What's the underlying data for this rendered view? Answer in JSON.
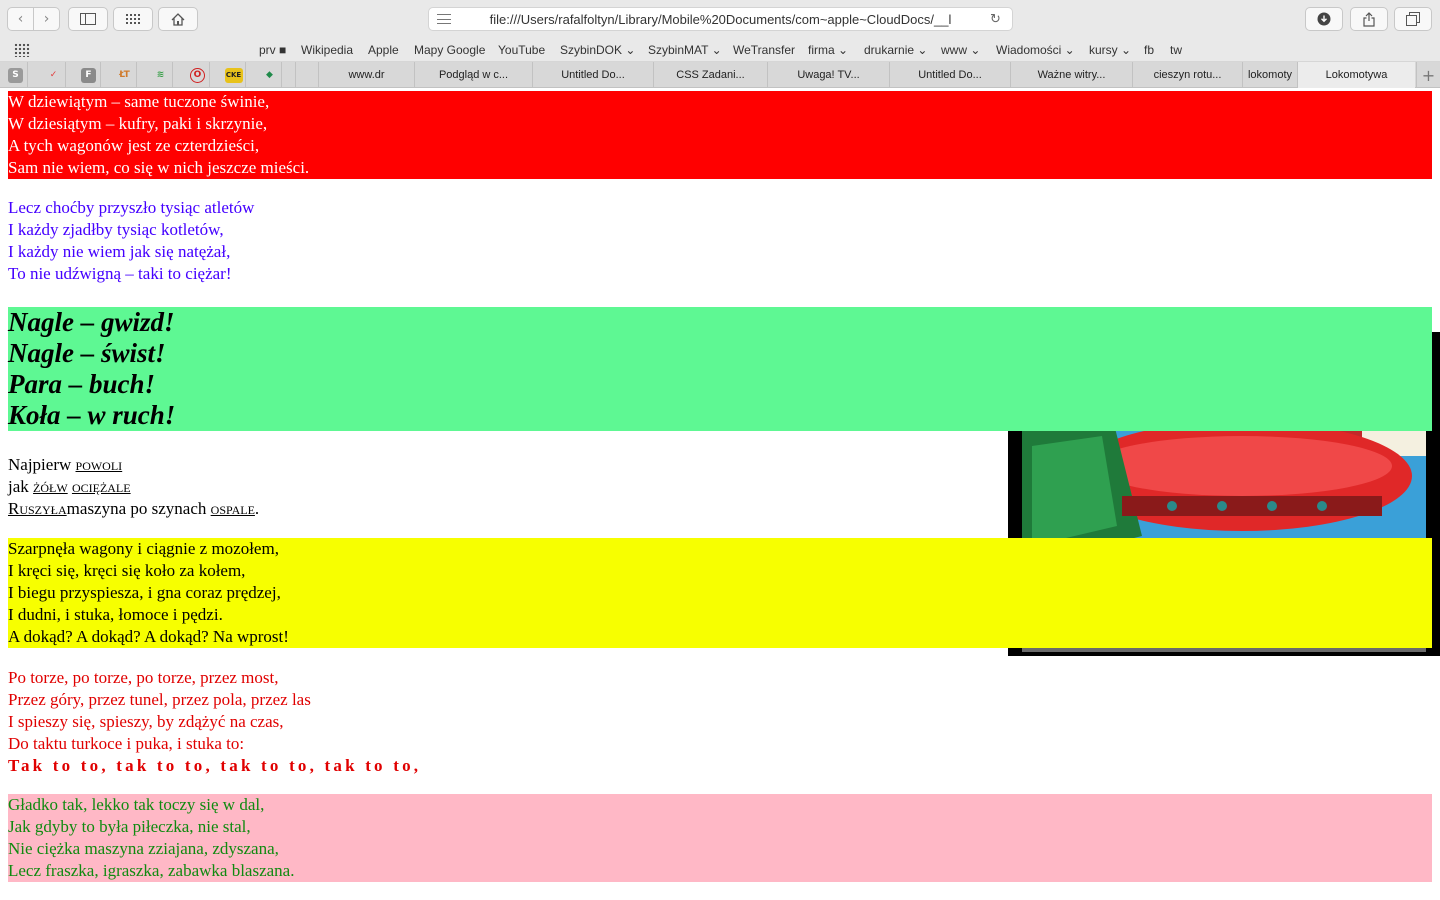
{
  "browser": {
    "url": "file:///Users/rafalfoltyn/Library/Mobile%20Documents/com~apple~CloudDocs/__l"
  },
  "favorites": [
    "prv ■",
    "Wikipedia",
    "Apple",
    "Mapy Google",
    "YouTube",
    "SzybinDOK ⌄",
    "SzybinMAT ⌄",
    "WeTransfer",
    "firma ⌄",
    "drukarnie ⌄",
    "www ⌄",
    "Wiadomości ⌄",
    "kursy ⌄",
    "fb",
    "tw"
  ],
  "pinned_tabs": [
    {
      "glyph": "S",
      "color": "#9a9a9a"
    },
    {
      "glyph": "✓",
      "color": "#e23b3b"
    },
    {
      "glyph": "F",
      "color": "#8a8a8a"
    },
    {
      "glyph": "ŁT",
      "color": "#d07a2a"
    },
    {
      "glyph": "≋",
      "color": "#3aa04a"
    },
    {
      "glyph": "O",
      "color": "#d02020"
    },
    {
      "glyph": "CKE",
      "color": "#e8c21a"
    },
    {
      "glyph": "◆",
      "color": "#1f8a4a"
    }
  ],
  "tabs": [
    "www.dr",
    "Podgląd w c...",
    "Untitled Do...",
    "CSS Zadani...",
    "Uwaga! TV...",
    "Untitled Do...",
    "Ważne witry...",
    "cieszyn rotu...",
    "lokomoty",
    "Lokomotywa"
  ],
  "poem": {
    "stanza1": [
      "W dziewiątym – same tuczone świnie,",
      "W dziesiątym – kufry, paki i skrzynie,",
      "A tych wagonów jest ze czterdzieści,",
      "Sam nie wiem, co się w nich jeszcze mieści."
    ],
    "stanza2": [
      "Lecz choćby przyszło tysiąc atletów",
      "I każdy zjadłby tysiąc kotletów,",
      "I każdy nie wiem jak się natężał,",
      "To nie udźwigną – taki to ciężar!"
    ],
    "stanza3": [
      "Nagle – gwizd!",
      "Nagle – świst!",
      "Para – buch!",
      "Koła – w ruch!"
    ],
    "stanza4": {
      "line1_start": "Najpierw",
      "line1_word": "powoli",
      "line2_start": "jak",
      "line2_word1": "żółw",
      "line2_word2": "ociężale",
      "line3_word": "Ruszyła",
      "line3_mid": "maszyna po szynach",
      "line3_word2": "ospale",
      "line3_end": "."
    },
    "stanza5": [
      "Szarpnęła wagony i ciągnie z mozołem,",
      "I kręci się, kręci się koło za kołem,",
      "I biegu przyspiesza, i gna coraz prędzej,",
      "I dudni, i stuka, łomoce i pędzi.",
      "A dokąd? A dokąd? A dokąd? Na wprost!"
    ],
    "stanza6": [
      "Po torze, po torze, po torze, przez most,",
      "Przez góry, przez tunel, przez pola, przez las",
      "I spieszy się, spieszy, by zdążyć na czas,",
      "Do taktu turkoce i puka, i stuka to:",
      "Tak to to, tak to to, tak to to, tak to to,"
    ],
    "stanza7": [
      "Gładko tak, lekko tak toczy się w dal,",
      "Jak gdyby to była piłeczka, nie stal,",
      "Nie ciężka maszyna zziajana, zdyszana,",
      "Lecz fraszka, igraszka, zabawka blaszana."
    ]
  },
  "colors": {
    "stanza1_bg": "#ff0000",
    "stanza2_text": "#4400ff",
    "stanza3_bg": "#5ef893",
    "stanza5_bg": "#f7ff00",
    "stanza6_text": "#e00000",
    "stanza7_bg": "#ffb8c6",
    "stanza7_text": "#108a10"
  }
}
